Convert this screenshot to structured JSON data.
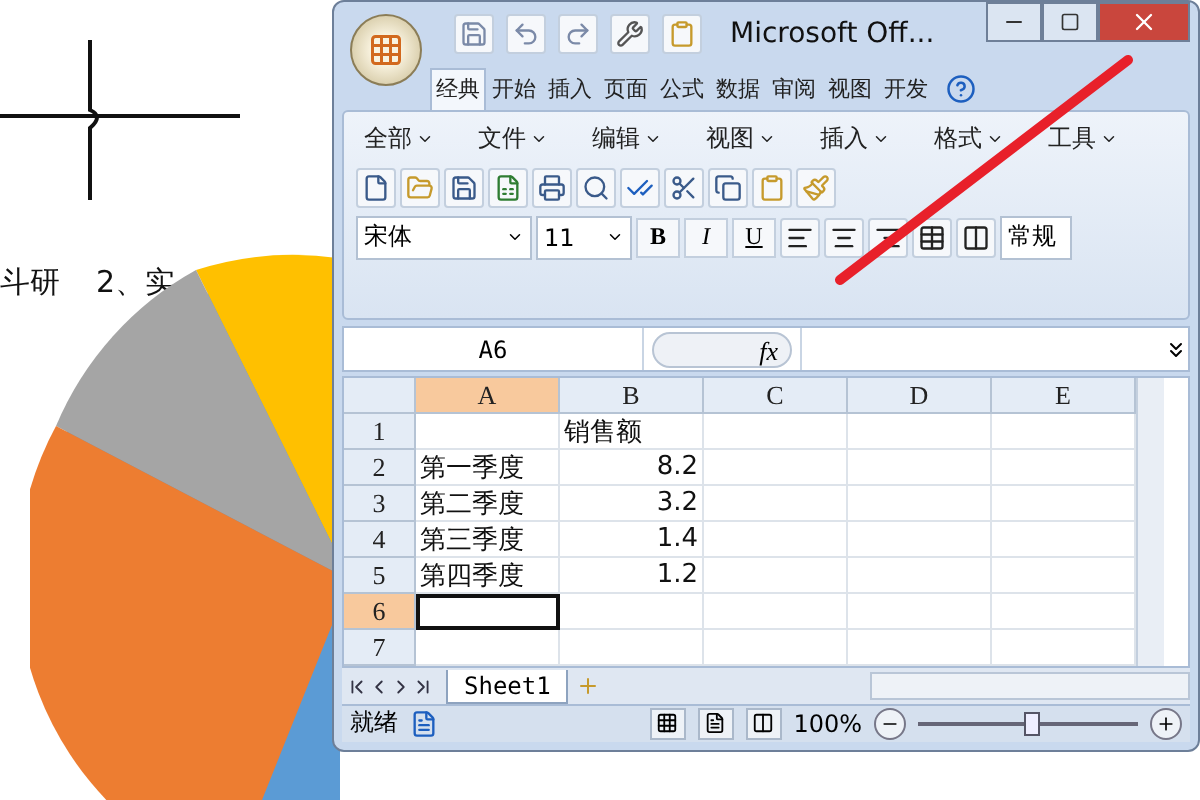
{
  "document": {
    "texts": [
      "斗研",
      "2、实"
    ]
  },
  "excel": {
    "title": "Microsoft Off...",
    "ribbon_tabs": [
      {
        "label": "经典",
        "selected": true
      },
      {
        "label": "开始",
        "selected": false
      },
      {
        "label": "插入",
        "selected": false
      },
      {
        "label": "页面",
        "selected": false
      },
      {
        "label": "公式",
        "selected": false
      },
      {
        "label": "数据",
        "selected": false
      },
      {
        "label": "审阅",
        "selected": false
      },
      {
        "label": "视图",
        "selected": false
      },
      {
        "label": "开发",
        "selected": false
      }
    ],
    "menus": [
      "全部",
      "文件",
      "编辑",
      "视图",
      "插入",
      "格式",
      "工具"
    ],
    "font": "宋体",
    "font_size": "11",
    "bold_label": "B",
    "italic_label": "I",
    "underline_label": "U",
    "number_format": "常规",
    "name_box": "A6",
    "fx": "fx",
    "columns": [
      {
        "label": "A",
        "selected": true
      },
      {
        "label": "B",
        "selected": false
      },
      {
        "label": "C",
        "selected": false
      },
      {
        "label": "D",
        "selected": false
      },
      {
        "label": "E",
        "selected": false
      }
    ],
    "rows": [
      {
        "label": "1",
        "selected": false,
        "b": "销售额"
      },
      {
        "label": "2",
        "selected": false,
        "a": "第一季度",
        "b": "8.2"
      },
      {
        "label": "3",
        "selected": false,
        "a": "第二季度",
        "b": "3.2"
      },
      {
        "label": "4",
        "selected": false,
        "a": "第三季度",
        "b": "1.4"
      },
      {
        "label": "5",
        "selected": false,
        "a": "第四季度",
        "b": "1.2"
      },
      {
        "label": "6",
        "selected": true
      },
      {
        "label": "7",
        "selected": false
      }
    ],
    "sheet_tabs": [
      {
        "label": "Sheet1",
        "selected": true
      }
    ],
    "status": "就绪",
    "zoom": {
      "label": "100%",
      "level": 0.52
    }
  }
}
